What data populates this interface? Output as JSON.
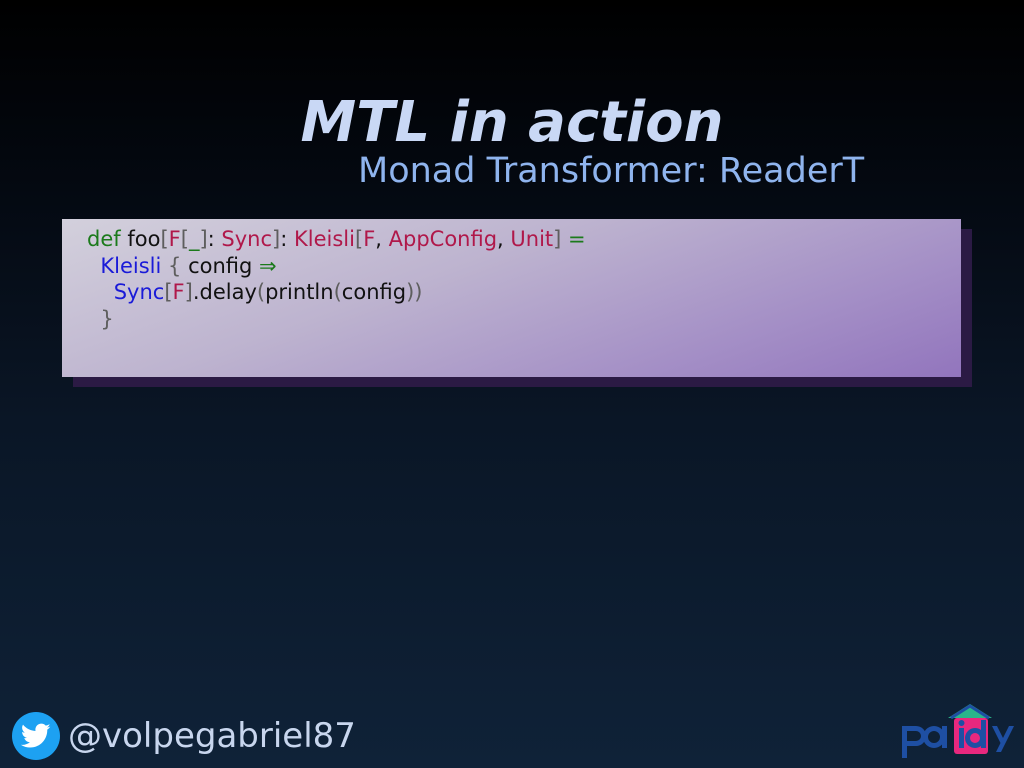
{
  "slide": {
    "title": "MTL in action",
    "subtitle": "Monad Transformer: ReaderT"
  },
  "code": {
    "lines": [
      [
        {
          "t": "def",
          "k": "kw"
        },
        {
          "t": " ",
          "k": "id"
        },
        {
          "t": "foo",
          "k": "id"
        },
        {
          "t": "[",
          "k": "br"
        },
        {
          "t": "F",
          "k": "ty"
        },
        {
          "t": "[",
          "k": "br"
        },
        {
          "t": "_",
          "k": "op"
        },
        {
          "t": "]",
          "k": "br"
        },
        {
          "t": ": ",
          "k": "pun"
        },
        {
          "t": "Sync",
          "k": "ty"
        },
        {
          "t": "]",
          "k": "br"
        },
        {
          "t": ": ",
          "k": "pun"
        },
        {
          "t": "Kleisli",
          "k": "ty"
        },
        {
          "t": "[",
          "k": "br"
        },
        {
          "t": "F",
          "k": "ty"
        },
        {
          "t": ", ",
          "k": "pun"
        },
        {
          "t": "AppConfig",
          "k": "ty"
        },
        {
          "t": ", ",
          "k": "pun"
        },
        {
          "t": "Unit",
          "k": "ty"
        },
        {
          "t": "]",
          "k": "br"
        },
        {
          "t": " ",
          "k": "id"
        },
        {
          "t": "=",
          "k": "op"
        }
      ],
      [
        {
          "t": "  ",
          "k": "id"
        },
        {
          "t": "Kleisli",
          "k": "fn"
        },
        {
          "t": " ",
          "k": "id"
        },
        {
          "t": "{",
          "k": "br"
        },
        {
          "t": " config ",
          "k": "id"
        },
        {
          "t": "⇒",
          "k": "op"
        }
      ],
      [
        {
          "t": "    ",
          "k": "id"
        },
        {
          "t": "Sync",
          "k": "fn"
        },
        {
          "t": "[",
          "k": "br"
        },
        {
          "t": "F",
          "k": "ty"
        },
        {
          "t": "]",
          "k": "br"
        },
        {
          "t": ".delay",
          "k": "id"
        },
        {
          "t": "(",
          "k": "br"
        },
        {
          "t": "println",
          "k": "id"
        },
        {
          "t": "(",
          "k": "br"
        },
        {
          "t": "config",
          "k": "id"
        },
        {
          "t": "))",
          "k": "br"
        }
      ],
      [
        {
          "t": "  ",
          "k": "id"
        },
        {
          "t": "}",
          "k": "br"
        }
      ]
    ]
  },
  "footer": {
    "twitter_icon": "twitter-bird-icon",
    "handle": "@volpegabriel87",
    "logo_text": "paidy",
    "colors": {
      "twitter": "#1da1f2",
      "logo_blue": "#1e4fa3",
      "logo_pink": "#e8287e",
      "logo_green": "#2bb58a"
    }
  }
}
